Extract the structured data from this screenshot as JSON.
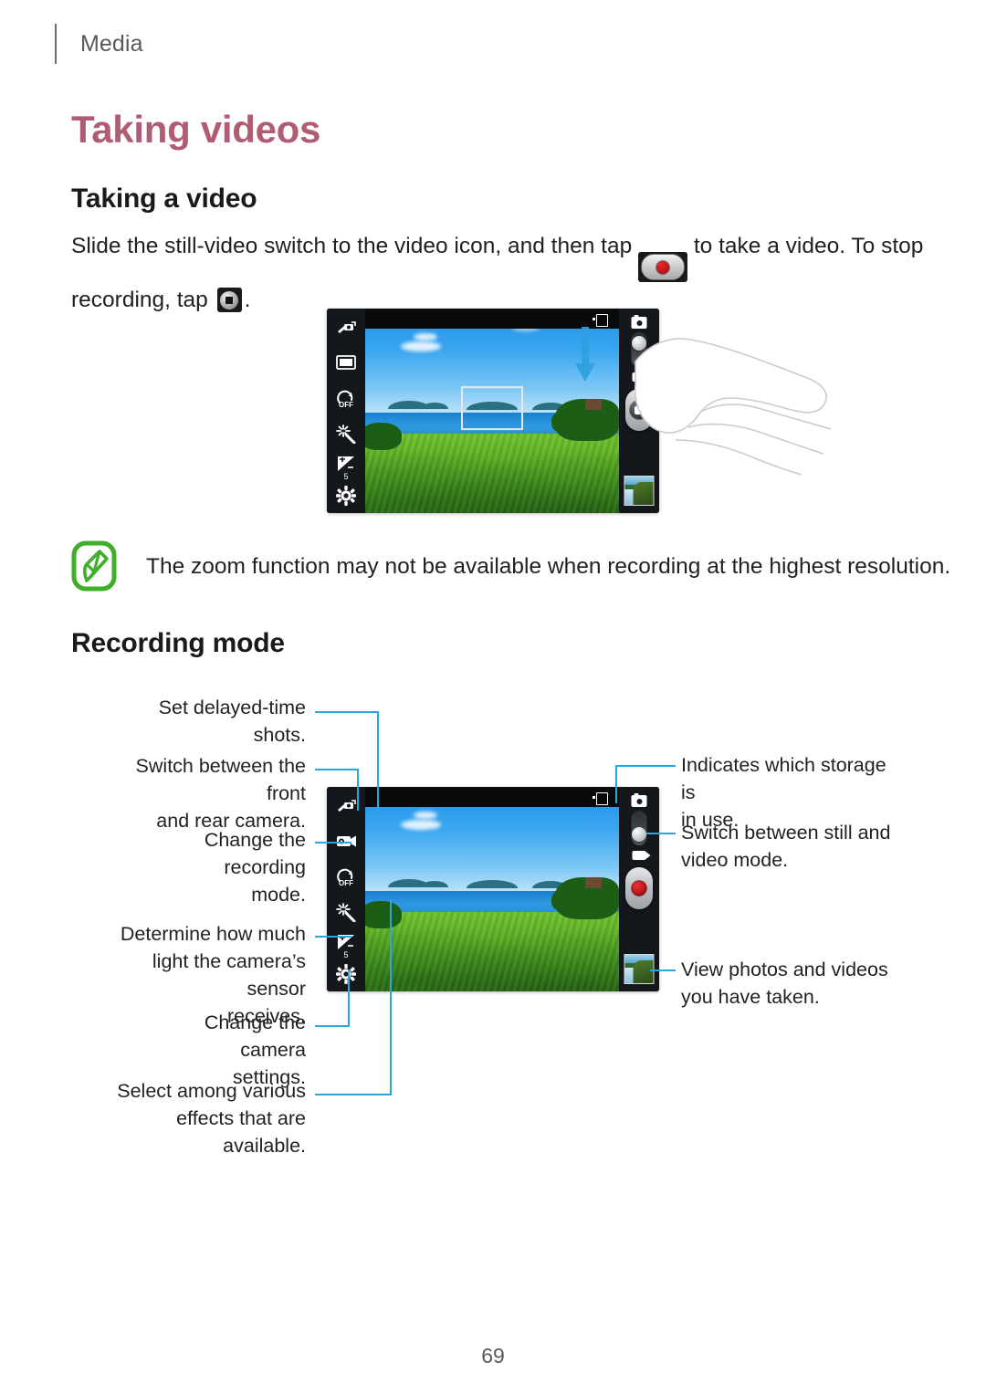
{
  "running_header": {
    "label": "Media"
  },
  "headings": {
    "title": "Taking videos",
    "sub_taking": "Taking a video",
    "sub_recording": "Recording mode"
  },
  "body": {
    "line1_a": "Slide the still-video switch to the video icon, and then tap",
    "line1_b": "to take a video. To stop",
    "line2_a": "recording, tap",
    "line2_b": ".",
    "icon_record": "record-button-icon",
    "icon_stop": "stop-button-icon"
  },
  "note": {
    "icon": "note-pen-icon",
    "text": "The zoom function may not be available when recording at the highest resolution."
  },
  "figure_top": {
    "name": "camera-preview-screenshot",
    "rail_icons": [
      "switch-camera-icon",
      "shooting-mode-icon",
      "timer-off-icon",
      "effects-wand-icon",
      "exposure-icon",
      "settings-gear-icon"
    ],
    "exposure_value": "5",
    "timer_label": "OFF",
    "storage_icon": "storage-indicator-icon",
    "mode_still_icon": "still-mode-icon",
    "mode_video_icon": "video-mode-icon",
    "shutter_icon": "camera-shutter-button",
    "gallery_thumb": "gallery-thumbnail",
    "gesture": "finger-swipe-down"
  },
  "figure_bottom": {
    "name": "recording-mode-screenshot",
    "rail_icons": [
      "switch-camera-icon",
      "recording-mode-icon",
      "timer-off-icon",
      "effects-wand-icon",
      "exposure-icon",
      "settings-gear-icon"
    ],
    "exposure_value": "5",
    "timer_label": "OFF",
    "storage_icon": "storage-indicator-icon",
    "mode_still_icon": "still-mode-icon",
    "mode_video_icon": "video-mode-icon",
    "record_icon": "record-shutter-button",
    "gallery_thumb": "gallery-thumbnail"
  },
  "annotations": {
    "left": [
      {
        "id": "delayed-time",
        "lines": [
          "Set delayed-time shots."
        ]
      },
      {
        "id": "switch-camera",
        "lines": [
          "Switch between the front",
          "and rear camera."
        ]
      },
      {
        "id": "recording-mode",
        "lines": [
          "Change the recording",
          "mode."
        ]
      },
      {
        "id": "exposure",
        "lines": [
          "Determine how much",
          "light the camera’s sensor",
          "receives."
        ]
      },
      {
        "id": "settings",
        "lines": [
          "Change the camera",
          "settings."
        ]
      },
      {
        "id": "effects",
        "lines": [
          "Select among various",
          "effects that are available."
        ]
      }
    ],
    "right": [
      {
        "id": "storage",
        "lines": [
          "Indicates which storage is",
          "in use."
        ]
      },
      {
        "id": "mode-switch",
        "lines": [
          "Switch between still and",
          "video mode."
        ]
      },
      {
        "id": "gallery",
        "lines": [
          "View photos and videos",
          "you have taken."
        ]
      }
    ]
  },
  "colors": {
    "title": "#b05c72",
    "lead_line": "#2aa8dd",
    "note_icon": "#3fae29",
    "text": "#231f20"
  },
  "page_number": "69"
}
